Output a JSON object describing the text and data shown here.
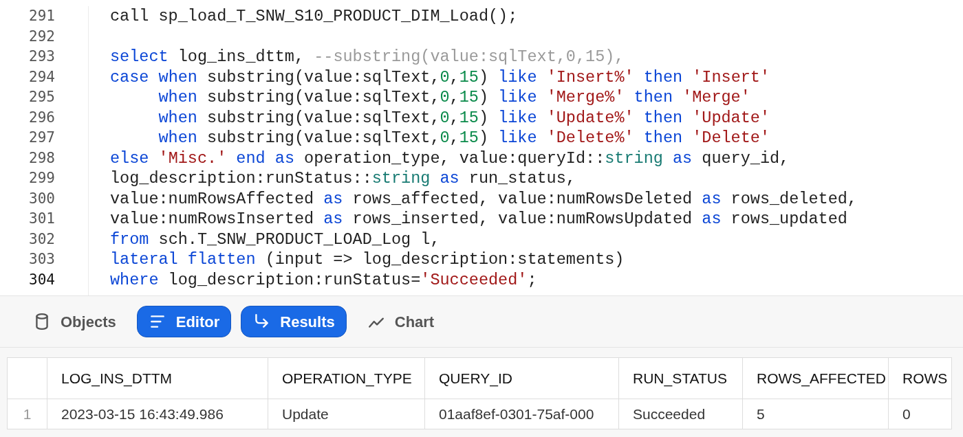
{
  "editor": {
    "lines": [
      {
        "number": "291",
        "current": false,
        "tokens": [
          {
            "kind": "plain",
            "text": "call sp_load_T_SNW_S10_PRODUCT_DIM_Load();"
          }
        ]
      },
      {
        "number": "292",
        "current": false
      },
      {
        "number": "293",
        "current": false,
        "tokens": [
          {
            "kind": "keyword",
            "text": "select"
          },
          {
            "kind": "plain",
            "text": " log_ins_dttm, "
          },
          {
            "kind": "comment",
            "text": "--substring(value:sqlText,0,15),"
          }
        ]
      },
      {
        "number": "294",
        "current": false,
        "tokens": [
          {
            "kind": "keyword",
            "text": "case"
          },
          {
            "kind": "keyword",
            "text": " when"
          },
          {
            "kind": "plain",
            "text": " substring(value:sqlText,"
          },
          {
            "kind": "number",
            "text": "0"
          },
          {
            "kind": "plain",
            "text": ","
          },
          {
            "kind": "number",
            "text": "15"
          },
          {
            "kind": "plain",
            "text": ") "
          },
          {
            "kind": "keyword",
            "text": "like"
          },
          {
            "kind": "string",
            "text": " 'Insert%'"
          },
          {
            "kind": "keyword",
            "text": " then"
          },
          {
            "kind": "string",
            "text": " 'Insert'"
          }
        ]
      },
      {
        "number": "295",
        "current": false,
        "tokens": [
          {
            "kind": "keyword",
            "text": "     when"
          },
          {
            "kind": "plain",
            "text": " substring(value:sqlText,"
          },
          {
            "kind": "number",
            "text": "0"
          },
          {
            "kind": "plain",
            "text": ","
          },
          {
            "kind": "number",
            "text": "15"
          },
          {
            "kind": "plain",
            "text": ") "
          },
          {
            "kind": "keyword",
            "text": "like"
          },
          {
            "kind": "string",
            "text": " 'Merge%'"
          },
          {
            "kind": "keyword",
            "text": " then"
          },
          {
            "kind": "string",
            "text": " 'Merge'"
          }
        ]
      },
      {
        "number": "296",
        "current": false,
        "tokens": [
          {
            "kind": "keyword",
            "text": "     when"
          },
          {
            "kind": "plain",
            "text": " substring(value:sqlText,"
          },
          {
            "kind": "number",
            "text": "0"
          },
          {
            "kind": "plain",
            "text": ","
          },
          {
            "kind": "number",
            "text": "15"
          },
          {
            "kind": "plain",
            "text": ") "
          },
          {
            "kind": "keyword",
            "text": "like"
          },
          {
            "kind": "string",
            "text": " 'Update%'"
          },
          {
            "kind": "keyword",
            "text": " then"
          },
          {
            "kind": "string",
            "text": " 'Update'"
          }
        ]
      },
      {
        "number": "297",
        "current": false,
        "tokens": [
          {
            "kind": "keyword",
            "text": "     when"
          },
          {
            "kind": "plain",
            "text": " substring(value:sqlText,"
          },
          {
            "kind": "number",
            "text": "0"
          },
          {
            "kind": "plain",
            "text": ","
          },
          {
            "kind": "number",
            "text": "15"
          },
          {
            "kind": "plain",
            "text": ") "
          },
          {
            "kind": "keyword",
            "text": "like"
          },
          {
            "kind": "string",
            "text": " 'Delete%'"
          },
          {
            "kind": "keyword",
            "text": " then"
          },
          {
            "kind": "string",
            "text": " 'Delete'"
          }
        ]
      },
      {
        "number": "298",
        "current": false,
        "tokens": [
          {
            "kind": "keyword",
            "text": "else"
          },
          {
            "kind": "string",
            "text": " 'Misc.'"
          },
          {
            "kind": "keyword",
            "text": " end"
          },
          {
            "kind": "keyword",
            "text": " as"
          },
          {
            "kind": "plain",
            "text": " operation_type, value:queryId::"
          },
          {
            "kind": "type",
            "text": "string"
          },
          {
            "kind": "keyword",
            "text": " as"
          },
          {
            "kind": "plain",
            "text": " query_id,"
          }
        ]
      },
      {
        "number": "299",
        "current": false,
        "tokens": [
          {
            "kind": "plain",
            "text": "log_description:runStatus::"
          },
          {
            "kind": "type",
            "text": "string"
          },
          {
            "kind": "keyword",
            "text": " as"
          },
          {
            "kind": "plain",
            "text": " run_status,"
          }
        ]
      },
      {
        "number": "300",
        "current": false,
        "tokens": [
          {
            "kind": "plain",
            "text": "value:numRowsAffected "
          },
          {
            "kind": "keyword",
            "text": "as"
          },
          {
            "kind": "plain",
            "text": " rows_affected, value:numRowsDeleted "
          },
          {
            "kind": "keyword",
            "text": "as"
          },
          {
            "kind": "plain",
            "text": " rows_deleted,"
          }
        ]
      },
      {
        "number": "301",
        "current": false,
        "tokens": [
          {
            "kind": "plain",
            "text": "value:numRowsInserted "
          },
          {
            "kind": "keyword",
            "text": "as"
          },
          {
            "kind": "plain",
            "text": " rows_inserted, value:numRowsUpdated "
          },
          {
            "kind": "keyword",
            "text": "as"
          },
          {
            "kind": "plain",
            "text": " rows_updated"
          }
        ]
      },
      {
        "number": "302",
        "current": false,
        "tokens": [
          {
            "kind": "keyword",
            "text": "from"
          },
          {
            "kind": "plain",
            "text": " sch.T_SNW_PRODUCT_LOAD_Log l,"
          }
        ]
      },
      {
        "number": "303",
        "current": false,
        "tokens": [
          {
            "kind": "keyword",
            "text": "lateral"
          },
          {
            "kind": "keyword",
            "text": " flatten"
          },
          {
            "kind": "plain",
            "text": " (input => log_description:statements)"
          }
        ]
      },
      {
        "number": "304",
        "current": true,
        "tokens": [
          {
            "kind": "keyword",
            "text": "where"
          },
          {
            "kind": "plain",
            "text": " log_description:runStatus="
          },
          {
            "kind": "string",
            "text": "'Succeeded'"
          },
          {
            "kind": "plain",
            "text": ";"
          }
        ]
      }
    ]
  },
  "toolbar": [
    {
      "label": "Objects",
      "selected": false
    },
    {
      "label": "Editor",
      "selected": true
    },
    {
      "label": "Results",
      "selected": true
    },
    {
      "label": "Chart",
      "selected": false
    }
  ],
  "table": {
    "columns": [
      "LOG_INS_DTTM",
      "OPERATION_TYPE",
      "QUERY_ID",
      "RUN_STATUS",
      "ROWS_AFFECTED",
      "ROWS"
    ],
    "rows": [
      {
        "number": "1",
        "cells": [
          "2023-03-15 16:43:49.986",
          "Update",
          "01aaf8ef-0301-75af-000",
          "Succeeded",
          "5",
          "0"
        ]
      }
    ]
  }
}
